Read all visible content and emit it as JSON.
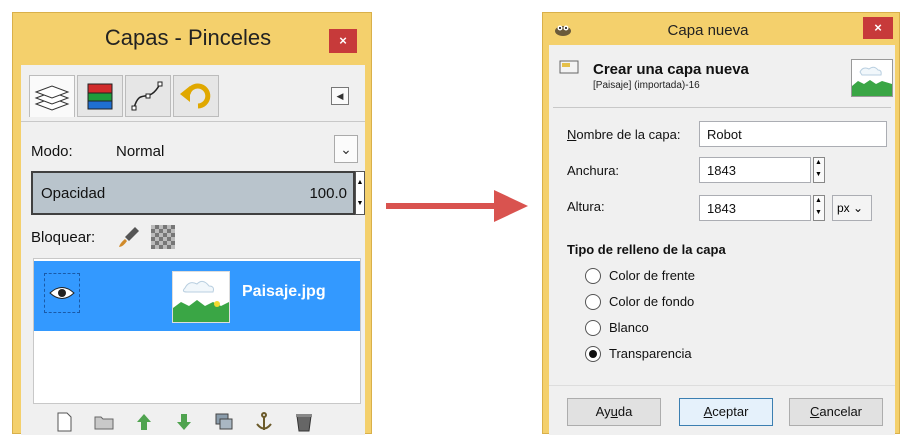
{
  "layers_panel": {
    "title": "Capas - Pinceles",
    "close_label": "×",
    "mode_label": "Modo:",
    "mode_value": "Normal",
    "opacity_label": "Opacidad",
    "opacity_value": "100.0",
    "lock_label": "Bloquear:",
    "layer": {
      "name": "Paisaje.jpg",
      "visible": true
    }
  },
  "dialog": {
    "title": "Capa nueva",
    "close_label": "×",
    "header_title": "Crear una capa nueva",
    "header_subtitle": "[Paisaje] (importada)-16",
    "name_label": "Nombre de la capa:",
    "name_value": "Robot",
    "width_label": "Anchura:",
    "width_value": "1843",
    "height_label": "Altura:",
    "height_value": "1843",
    "unit_value": "px",
    "fill_title": "Tipo de relleno de la capa",
    "fill_options": [
      "Color de frente",
      "Color de fondo",
      "Blanco",
      "Transparencia"
    ],
    "fill_selected": "Transparencia",
    "buttons": {
      "help": "Ayuda",
      "ok": "Aceptar",
      "cancel": "Cancelar"
    }
  },
  "colors": {
    "window_frame": "#f4d06c",
    "selection": "#3399ff",
    "arrow": "#d9534f",
    "close": "#c73a3a"
  }
}
